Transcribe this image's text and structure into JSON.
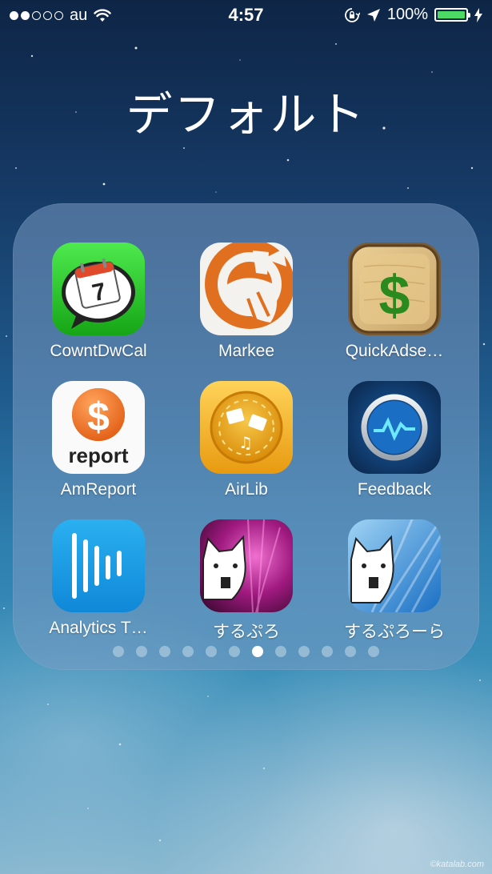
{
  "status_bar": {
    "carrier": "au",
    "time": "4:57",
    "battery_percent": "100%",
    "signal_bars_filled": 2,
    "signal_bars_total": 5,
    "icons": [
      "wifi-icon",
      "orientation-lock-icon",
      "location-arrow-icon",
      "battery-icon",
      "charging-bolt-icon"
    ],
    "battery_color": "#4cd964"
  },
  "folder": {
    "title": "デフォルト",
    "apps": [
      {
        "label": "CowntDwCal",
        "icon": "calendar-7-icon"
      },
      {
        "label": "Markee",
        "icon": "markee-icon"
      },
      {
        "label": "QuickAdse…",
        "icon": "dollar-wood-icon"
      },
      {
        "label": "AmReport",
        "icon": "dollar-report-icon",
        "icon_text": "report"
      },
      {
        "label": "AirLib",
        "icon": "airlib-icon"
      },
      {
        "label": "Feedback",
        "icon": "feedback-icon"
      },
      {
        "label": "Analytics T…",
        "icon": "analytics-bars-icon"
      },
      {
        "label": "するぷろ",
        "icon": "surupro-cat-icon"
      },
      {
        "label": "するぷろーら",
        "icon": "suruprora-cat-icon"
      }
    ],
    "page_count": 12,
    "current_page": 7
  },
  "watermark": "©katalab.com"
}
